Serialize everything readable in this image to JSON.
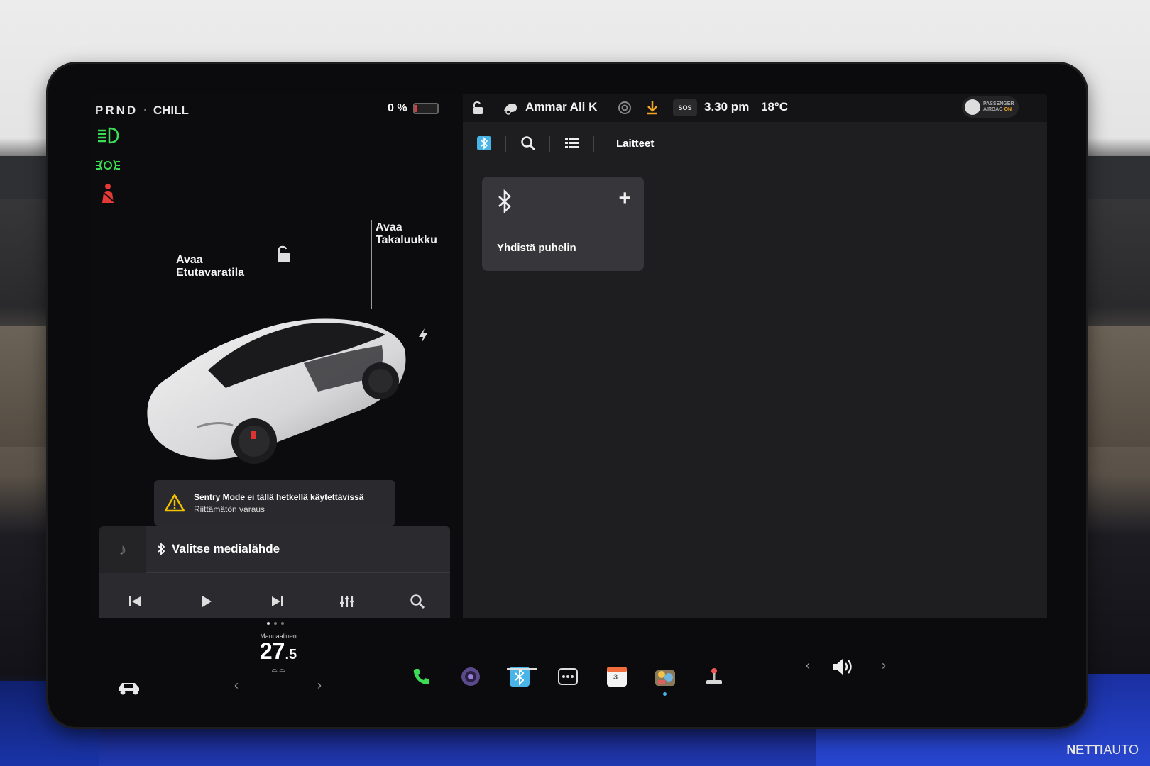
{
  "vehicle": {
    "gear": "PRND",
    "drive_mode": "CHILL",
    "battery_percent": "0 %",
    "battery_level": 0.02
  },
  "callouts": {
    "frunk": [
      "Avaa",
      "Etutavaratila"
    ],
    "trunk": [
      "Avaa",
      "Takaluukku"
    ]
  },
  "alert": {
    "title": "Sentry Mode ei tällä hetkellä käytettävissä",
    "subtitle": "Riittämätön varaus"
  },
  "media": {
    "source_label": "Valitse medialähde"
  },
  "status_bar": {
    "profile_name": "Ammar Ali K",
    "sos_label": "SOS",
    "time": "3.30 pm",
    "temperature": "18°C",
    "airbag_line1": "PASSENGER",
    "airbag_line2": "AIRBAG",
    "airbag_state": "ON"
  },
  "app_toolbar": {
    "devices_label": "Laitteet"
  },
  "bluetooth_card": {
    "label": "Yhdistä puhelin"
  },
  "climate": {
    "mode_label": "Manuaalinen",
    "temp_whole": "27",
    "temp_decimal": ".5"
  },
  "calendar_day": "3",
  "colors": {
    "accent_green": "#3ddc56",
    "warning_red": "#e53935",
    "bluetooth_blue": "#48b4e8",
    "airbag_orange": "#f5a623"
  },
  "watermark": {
    "brand_bold": "NETTI",
    "brand_light": "AUTO"
  }
}
